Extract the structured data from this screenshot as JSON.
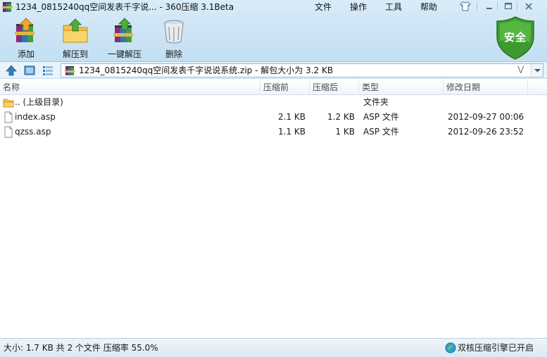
{
  "window": {
    "title": "1234_0815240qq空间发表千字说... - 360压缩 3.1Beta",
    "menu": {
      "file": "文件",
      "operation": "操作",
      "tools": "工具",
      "help": "帮助"
    }
  },
  "toolbar": {
    "add": "添加",
    "extract_to": "解压到",
    "one_click_extract": "一键解压",
    "delete": "删除",
    "security_badge": "安全"
  },
  "address": {
    "path": "1234_0815240qq空间发表千字说说系统.zip - 解包大小为 3.2 KB",
    "verify_mark": "V"
  },
  "columns": {
    "name": "名称",
    "packed": "压缩前",
    "original": "压缩后",
    "type": "类型",
    "modified": "修改日期"
  },
  "files": [
    {
      "icon": "folder-icon",
      "name": ".. (上级目录)",
      "packed": "",
      "original": "",
      "type": "文件夹",
      "modified": ""
    },
    {
      "icon": "file-icon",
      "name": "index.asp",
      "packed": "2.1 KB",
      "original": "1.2 KB",
      "type": "ASP 文件",
      "modified": "2012-09-27 00:06"
    },
    {
      "icon": "file-icon",
      "name": "qzss.asp",
      "packed": "1.1 KB",
      "original": "1 KB",
      "type": "ASP 文件",
      "modified": "2012-09-26 23:52"
    }
  ],
  "status": {
    "summary": "大小: 1.7 KB 共 2 个文件 压缩率 55.0%",
    "engine": "双核压缩引擎已开启"
  },
  "colors": {
    "chrome_top": "#d9ecf8",
    "shield_green": "#3e9a2f",
    "accent_blue": "#2f7fc1"
  }
}
